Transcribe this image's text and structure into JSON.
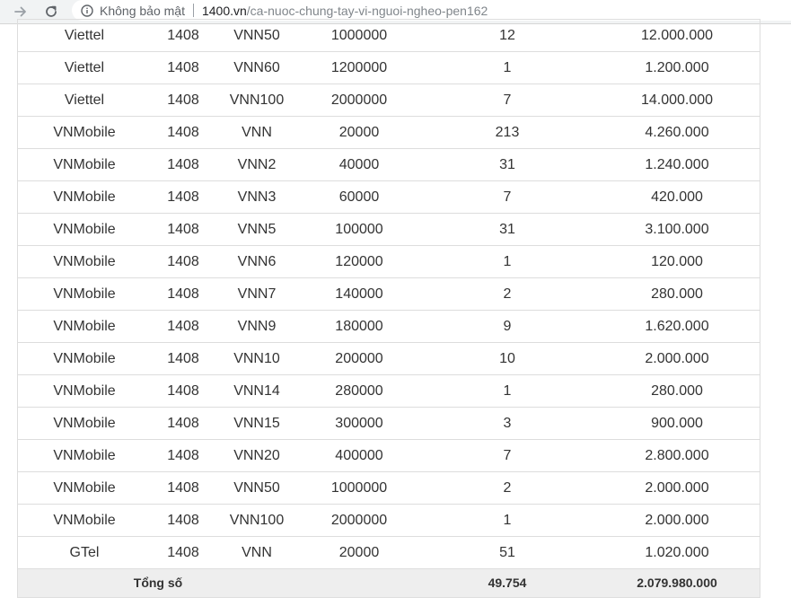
{
  "browser": {
    "security_label": "Không bảo mật",
    "url_host": "1400.vn",
    "url_path": "/ca-nuoc-chung-tay-vi-nguoi-ngheo-pen162"
  },
  "table": {
    "rows": [
      [
        "Viettel",
        "1408",
        "VNN50",
        "1000000",
        "12",
        "12.000.000"
      ],
      [
        "Viettel",
        "1408",
        "VNN60",
        "1200000",
        "1",
        "1.200.000"
      ],
      [
        "Viettel",
        "1408",
        "VNN100",
        "2000000",
        "7",
        "14.000.000"
      ],
      [
        "VNMobile",
        "1408",
        "VNN",
        "20000",
        "213",
        "4.260.000"
      ],
      [
        "VNMobile",
        "1408",
        "VNN2",
        "40000",
        "31",
        "1.240.000"
      ],
      [
        "VNMobile",
        "1408",
        "VNN3",
        "60000",
        "7",
        "420.000"
      ],
      [
        "VNMobile",
        "1408",
        "VNN5",
        "100000",
        "31",
        "3.100.000"
      ],
      [
        "VNMobile",
        "1408",
        "VNN6",
        "120000",
        "1",
        "120.000"
      ],
      [
        "VNMobile",
        "1408",
        "VNN7",
        "140000",
        "2",
        "280.000"
      ],
      [
        "VNMobile",
        "1408",
        "VNN9",
        "180000",
        "9",
        "1.620.000"
      ],
      [
        "VNMobile",
        "1408",
        "VNN10",
        "200000",
        "10",
        "2.000.000"
      ],
      [
        "VNMobile",
        "1408",
        "VNN14",
        "280000",
        "1",
        "280.000"
      ],
      [
        "VNMobile",
        "1408",
        "VNN15",
        "300000",
        "3",
        "900.000"
      ],
      [
        "VNMobile",
        "1408",
        "VNN20",
        "400000",
        "7",
        "2.800.000"
      ],
      [
        "VNMobile",
        "1408",
        "VNN50",
        "1000000",
        "2",
        "2.000.000"
      ],
      [
        "VNMobile",
        "1408",
        "VNN100",
        "2000000",
        "1",
        "2.000.000"
      ],
      [
        "GTel",
        "1408",
        "VNN",
        "20000",
        "51",
        "1.020.000"
      ]
    ],
    "total": {
      "label": "Tổng số",
      "count": "49.754",
      "amount": "2.079.980.000"
    }
  }
}
